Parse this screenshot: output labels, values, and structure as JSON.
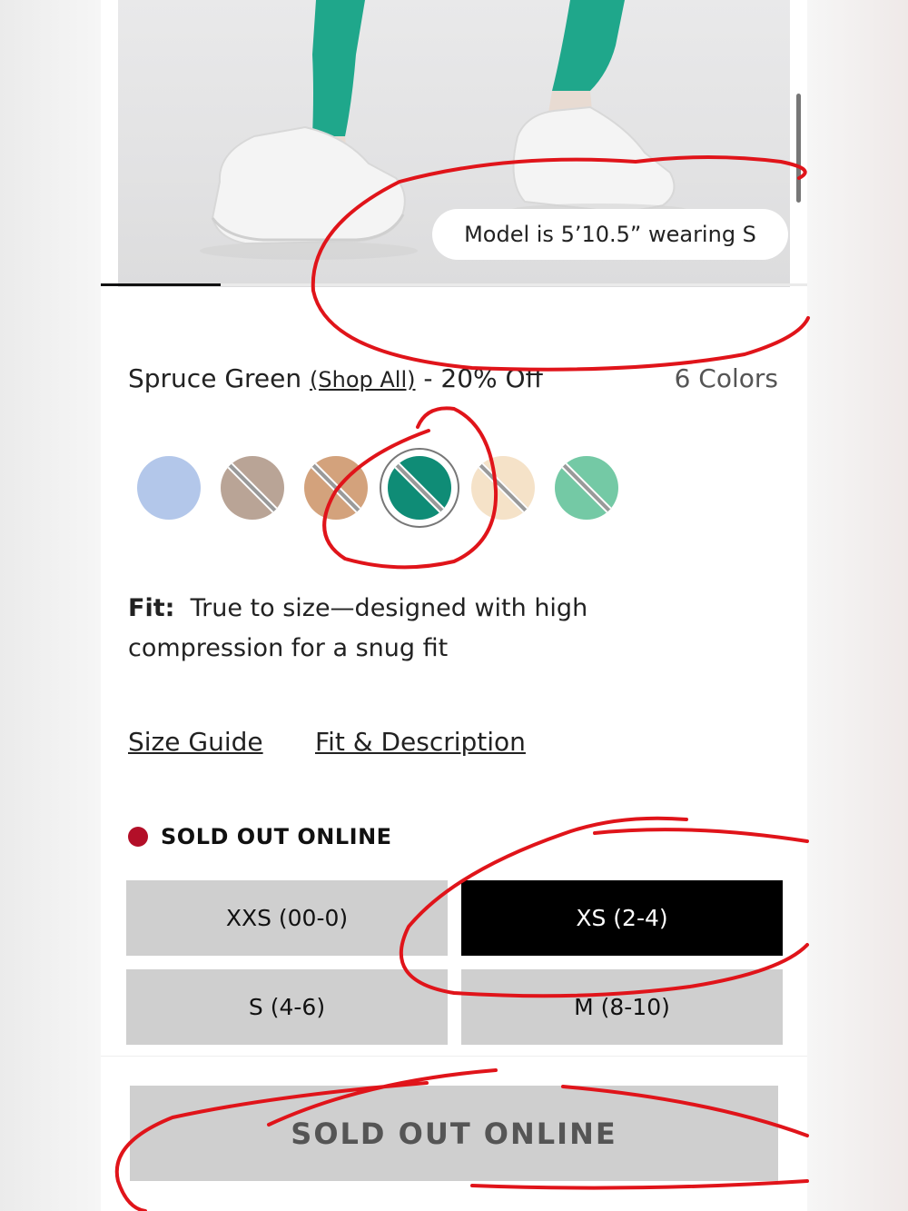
{
  "product_image": {
    "model_info": "Model is 5’10.5” wearing S",
    "gallery_progress": 0.17
  },
  "color": {
    "name": "Spruce Green",
    "shop_all": "(Shop All)",
    "discount": "- 20% Off",
    "count_label": "6 Colors",
    "swatches": [
      {
        "color": "#b3c7ea",
        "crossed": false,
        "selected": false
      },
      {
        "color": "#b9a496",
        "crossed": true,
        "selected": false
      },
      {
        "color": "#d3a27c",
        "crossed": true,
        "selected": false
      },
      {
        "color": "#0f8c76",
        "crossed": true,
        "selected": true
      },
      {
        "color": "#f5e2c8",
        "crossed": true,
        "selected": false
      },
      {
        "color": "#74c9a5",
        "crossed": true,
        "selected": false
      }
    ]
  },
  "fit": {
    "label": "Fit:",
    "text": "True to size—designed with high compression for a snug fit"
  },
  "links": {
    "size_guide": "Size Guide",
    "fit_description": "Fit & Description"
  },
  "availability": {
    "label": "SOLD OUT ONLINE",
    "dot_color": "#b30f28"
  },
  "sizes": [
    {
      "label": "XXS (00-0)",
      "selected": false
    },
    {
      "label": "XS (2-4)",
      "selected": true
    },
    {
      "label": "S (4-6)",
      "selected": false
    },
    {
      "label": "M (8-10)",
      "selected": false
    }
  ],
  "cta": {
    "label": "SOLD OUT ONLINE"
  },
  "annotation_color": "#e0141a"
}
